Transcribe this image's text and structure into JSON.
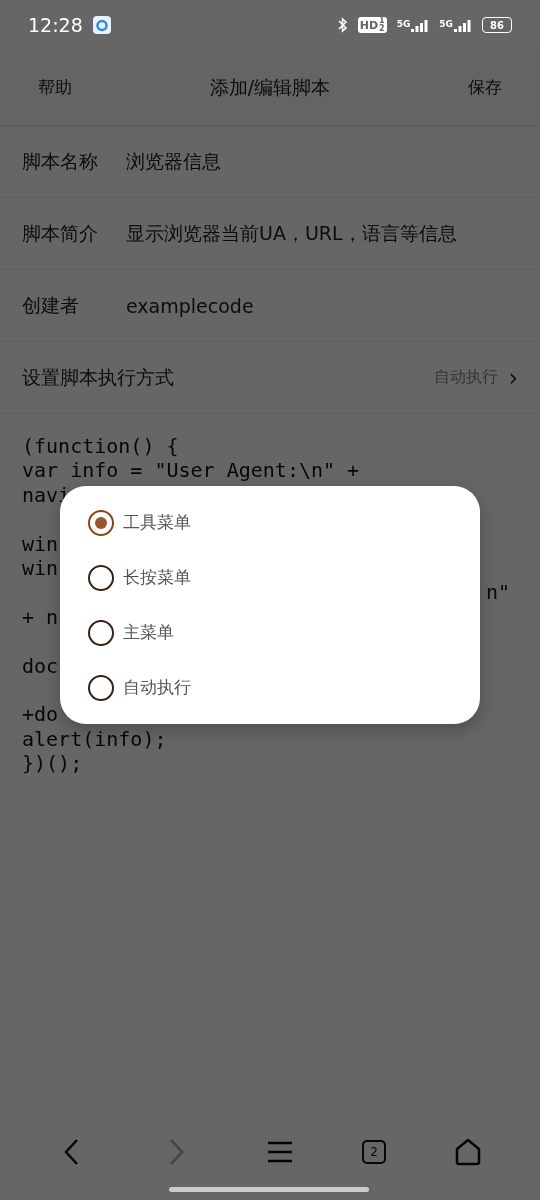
{
  "status_bar": {
    "time": "12:28",
    "hd_badge": {
      "main": "HD",
      "sub": [
        "1",
        "2"
      ]
    },
    "networks": [
      "5G",
      "5G"
    ],
    "battery": "86"
  },
  "header": {
    "left": "帮助",
    "title": "添加/编辑脚本",
    "right": "保存"
  },
  "fields": [
    {
      "label": "脚本名称",
      "value": "浏览器信息"
    },
    {
      "label": "脚本简介",
      "value": "显示浏览器当前UA，URL，语言等信息"
    },
    {
      "label": "创建者",
      "value": "examplecode"
    }
  ],
  "mode_row": {
    "label": "设置脚本执行方式",
    "value": "自动执行",
    "chevron": "›"
  },
  "code_lines": [
    {
      "kind": "line",
      "text": "(function() {"
    },
    {
      "kind": "line",
      "text": "var info = \"User Agent:\\n\" +"
    },
    {
      "kind": "line",
      "text": "navi"
    },
    {
      "kind": "blank"
    },
    {
      "kind": "line",
      "text": "win"
    },
    {
      "kind": "line",
      "text": "win"
    },
    {
      "kind": "tail",
      "text": "n\""
    },
    {
      "kind": "line",
      "text": "+ n"
    },
    {
      "kind": "blank"
    },
    {
      "kind": "line",
      "text": "doc"
    },
    {
      "kind": "blank"
    },
    {
      "kind": "line",
      "text": "+do"
    },
    {
      "kind": "line",
      "text": "alert(info);"
    },
    {
      "kind": "line",
      "text": "})();"
    }
  ],
  "dialog": {
    "options": [
      {
        "label": "工具菜单",
        "selected": true
      },
      {
        "label": "长按菜单",
        "selected": false
      },
      {
        "label": "主菜单",
        "selected": false
      },
      {
        "label": "自动执行",
        "selected": false
      }
    ]
  },
  "bottom_nav": {
    "forward_disabled": true,
    "tab_count": "2"
  }
}
